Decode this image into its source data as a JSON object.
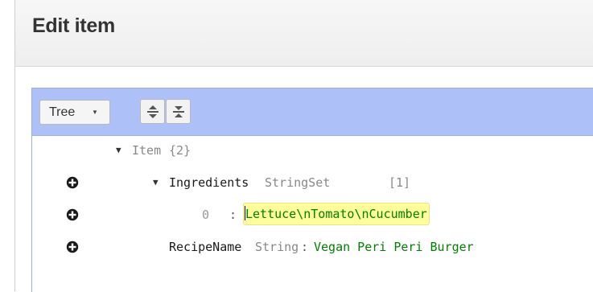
{
  "dialog": {
    "title": "Edit item"
  },
  "editor": {
    "mode_label": "Tree",
    "toolbar": {
      "expand_all_icon": "expand-all-icon",
      "collapse_all_icon": "collapse-all-icon"
    },
    "tree": {
      "root": {
        "field": "Item",
        "count": "{2}"
      },
      "ingredients": {
        "field": "Ingredients",
        "type": "StringSet",
        "count": "[1]",
        "items": [
          {
            "index": "0",
            "value": "Lettuce\\nTomato\\nCucumber"
          }
        ]
      },
      "recipe_name": {
        "field": "RecipeName",
        "type": "String",
        "value": "Vegan Peri Peri Burger"
      },
      "separator": ":",
      "expanded_glyph": "▼"
    }
  },
  "colors": {
    "menubar": "#aec0f8",
    "value_text": "#008000",
    "edit_highlight": "#fffe9a"
  }
}
